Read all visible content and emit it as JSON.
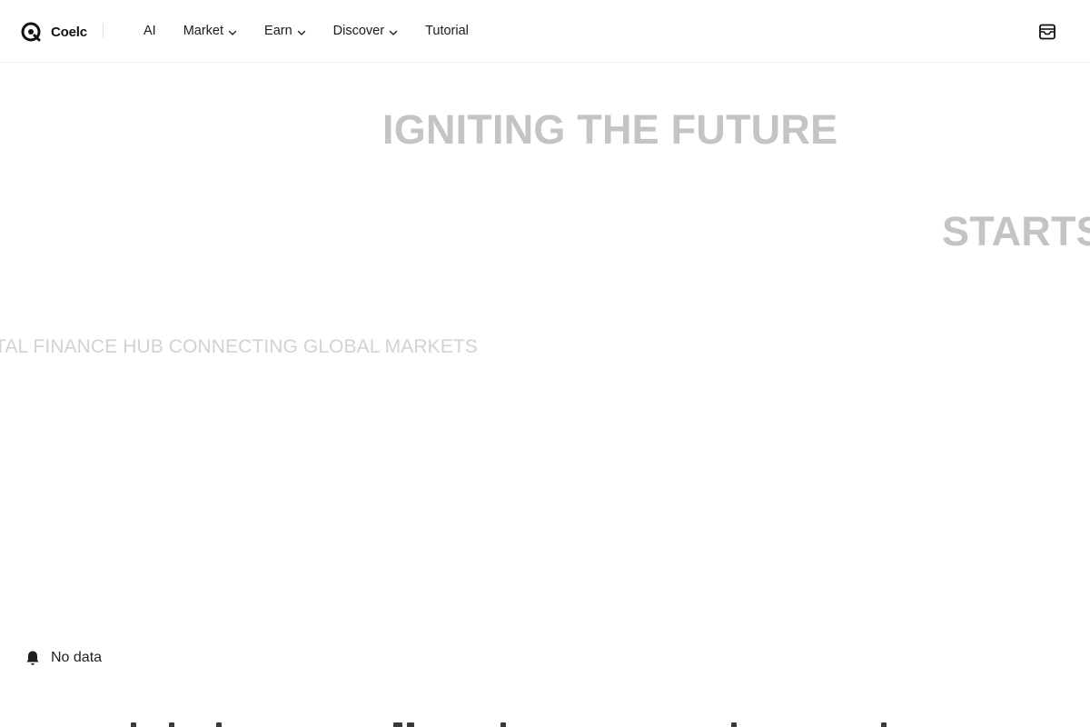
{
  "header": {
    "brand": "Coelc",
    "logo_icon": "coelc-logo-icon",
    "nav": [
      {
        "label": "AI",
        "has_dropdown": false
      },
      {
        "label": "Market",
        "has_dropdown": true
      },
      {
        "label": "Earn",
        "has_dropdown": true
      },
      {
        "label": "Discover",
        "has_dropdown": true
      },
      {
        "label": "Tutorial",
        "has_dropdown": false
      }
    ],
    "right_icon": "inbox-icon"
  },
  "hero": {
    "line1": "IGNITING THE FUTURE",
    "line2": "STARTS",
    "line3": "TAL FINANCE HUB CONNECTING GLOBAL MARKETS"
  },
  "ticker": {
    "icon": "bell-icon",
    "text": "No data"
  },
  "colors": {
    "hero_text": "#c4c4c4",
    "subtitle_text": "#d2d2d2",
    "nav_text": "#1a1a1a",
    "header_border": "#efefef"
  }
}
